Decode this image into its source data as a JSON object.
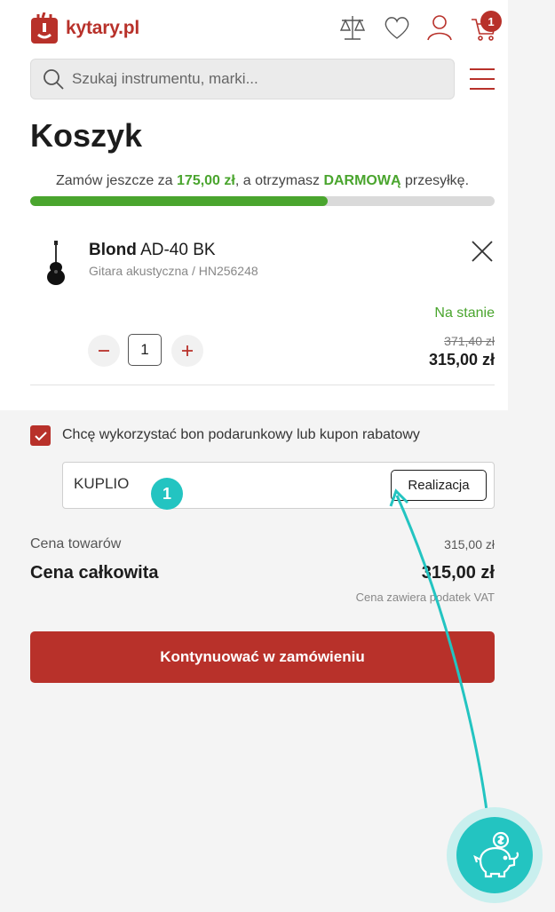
{
  "header": {
    "logo_text": "kytary.pl",
    "cart_count": "1",
    "search_placeholder": "Szukaj instrumentu, marki..."
  },
  "page_title": "Koszyk",
  "shipping": {
    "prefix": "Zamów jeszcze za",
    "amount": "175,00 zł",
    "middle": ", a otrzymasz",
    "highlight": "DARMOWĄ",
    "suffix": "przesyłkę.",
    "progress_percent": 64
  },
  "product": {
    "brand": "Blond",
    "model": "AD-40 BK",
    "subtitle": "Gitara akustyczna / HN256248",
    "availability": "Na stanie",
    "quantity": "1",
    "old_price": "371,40 zł",
    "price": "315,00 zł"
  },
  "coupon": {
    "checkbox_label": "Chcę wykorzystać bon podarunkowy lub kupon rabatowy",
    "checked": true,
    "code_value": "KUPLIO",
    "redeem_label": "Realizacja",
    "step_badge": "1"
  },
  "summary": {
    "goods_label": "Cena towarów",
    "goods_value": "315,00 zł",
    "total_label": "Cena całkowita",
    "total_value": "315,00 zł",
    "vat_note": "Cena zawiera podatek VAT"
  },
  "continue_label": "Kontynuować w zamówieniu",
  "colors": {
    "brand_red": "#b8312a",
    "green": "#4aa52e",
    "teal": "#23c4c1"
  }
}
